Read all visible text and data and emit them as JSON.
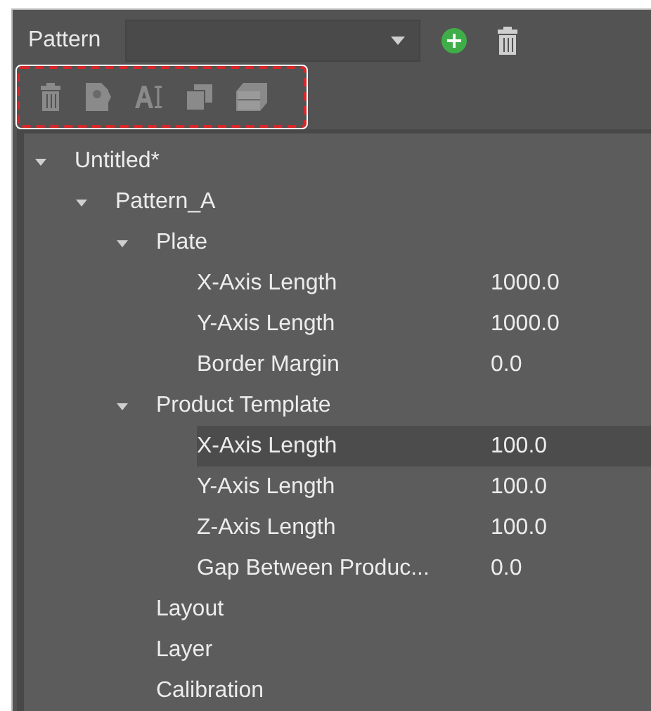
{
  "header": {
    "label": "Pattern"
  },
  "toolbar": {
    "disabled": true,
    "highlighted": true
  },
  "tree": [
    {
      "label": "Untitled*",
      "expanded": true,
      "selected": false,
      "children": [
        {
          "label": "Pattern_A",
          "expanded": true,
          "selected": false,
          "children": [
            {
              "label": "Plate",
              "expanded": true,
              "selected": false,
              "children": [
                {
                  "label": "X-Axis Length",
                  "value": "1000.0",
                  "selected": false
                },
                {
                  "label": "Y-Axis Length",
                  "value": "1000.0",
                  "selected": false
                },
                {
                  "label": "Border Margin",
                  "value": "0.0",
                  "selected": false
                }
              ]
            },
            {
              "label": "Product Template",
              "expanded": true,
              "selected": false,
              "children": [
                {
                  "label": "X-Axis Length",
                  "value": "100.0",
                  "selected": true
                },
                {
                  "label": "Y-Axis Length",
                  "value": "100.0",
                  "selected": false
                },
                {
                  "label": "Z-Axis Length",
                  "value": "100.0",
                  "selected": false
                },
                {
                  "label": "Gap Between Produc...",
                  "value": "0.0",
                  "selected": false
                }
              ]
            },
            {
              "label": "Layout",
              "selected": false
            },
            {
              "label": "Layer",
              "selected": false
            },
            {
              "label": "Calibration",
              "selected": false
            }
          ]
        }
      ]
    }
  ]
}
